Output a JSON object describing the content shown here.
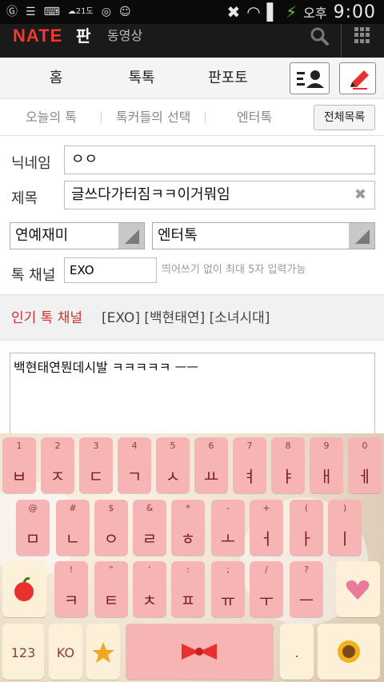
{
  "status_bar": {
    "icons": [
      "carrier-g-icon",
      "notes-icon",
      "keyboard-icon",
      "weather-icon",
      "badge-icon",
      "avatar-icon"
    ],
    "weather_temp": "21도",
    "ampm": "오후",
    "time": "9:00"
  },
  "app_header": {
    "logo": "NATE",
    "section": "판",
    "video": "동영상"
  },
  "main_tabs": [
    {
      "label": "홈"
    },
    {
      "label": "톡톡"
    },
    {
      "label": "판포토"
    }
  ],
  "sub_tabs": [
    {
      "label": "오늘의 톡"
    },
    {
      "label": "톡커들의 선택"
    },
    {
      "label": "엔터톡"
    }
  ],
  "all_list_label": "전체목록",
  "form": {
    "nickname_label": "닉네임",
    "nickname_value": "ㅇㅇ",
    "title_label": "제목",
    "title_value": "글쓰다가터짐ㅋㅋ이거뭐임",
    "category_primary": "연예재미",
    "category_secondary": "엔터톡",
    "channel_label": "톡 채널",
    "channel_value": "EXO",
    "channel_hint": "띄어쓰기 없이 최대 5자 입력가능"
  },
  "popular_channels": {
    "label": "인기 톡 채널",
    "items_text": "[EXO] [백현태연] [소녀시대]"
  },
  "body_text": "백현태연뭔데시발 ㅋㅋㅋㅋㅋ ㅡㅡ",
  "keyboard": {
    "row1": [
      {
        "top": "1",
        "main": "ㅂ"
      },
      {
        "top": "2",
        "main": "ㅈ"
      },
      {
        "top": "3",
        "main": "ㄷ"
      },
      {
        "top": "4",
        "main": "ㄱ"
      },
      {
        "top": "5",
        "main": "ㅅ"
      },
      {
        "top": "6",
        "main": "ㅛ"
      },
      {
        "top": "7",
        "main": "ㅕ"
      },
      {
        "top": "8",
        "main": "ㅑ"
      },
      {
        "top": "9",
        "main": "ㅐ"
      },
      {
        "top": "0",
        "main": "ㅔ"
      }
    ],
    "row2": [
      {
        "top": "@",
        "main": "ㅁ"
      },
      {
        "top": "#",
        "main": "ㄴ"
      },
      {
        "top": "$",
        "main": "ㅇ"
      },
      {
        "top": "&",
        "main": "ㄹ"
      },
      {
        "top": "*",
        "main": "ㅎ"
      },
      {
        "top": "-",
        "main": "ㅗ"
      },
      {
        "top": "+",
        "main": "ㅓ"
      },
      {
        "top": "(",
        "main": "ㅏ"
      },
      {
        "top": ")",
        "main": "ㅣ"
      }
    ],
    "row3": [
      {
        "top": "!",
        "main": "ㅋ"
      },
      {
        "top": "\"",
        "main": "ㅌ"
      },
      {
        "top": "'",
        "main": "ㅊ"
      },
      {
        "top": ":",
        "main": "ㅍ"
      },
      {
        "top": ";",
        "main": "ㅠ"
      },
      {
        "top": "/",
        "main": "ㅜ"
      },
      {
        "top": "?",
        "main": "ㅡ"
      }
    ],
    "num_key": "123",
    "lang_key": "KO",
    "punct_key": "."
  },
  "colors": {
    "status_bg": "#0a0a0a",
    "nate_red": "#ef3a2e",
    "popular_label": "#d42e2e",
    "key_pink": "#f6b4b4",
    "key_cream": "#fdf0d9"
  }
}
